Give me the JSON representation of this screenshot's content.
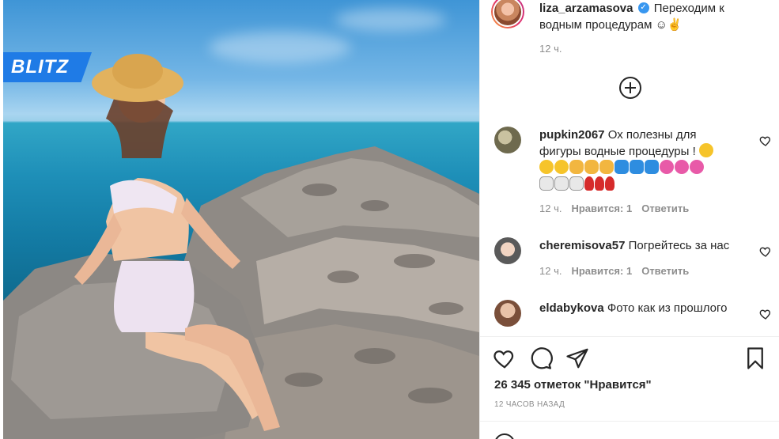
{
  "branding": {
    "logo_text": "BLITZ"
  },
  "post": {
    "author": "liza_arzamasova",
    "verified_mark": "✓",
    "caption": "Переходим к водным процедурам ☺✌",
    "time": "12 ч."
  },
  "comments": [
    {
      "user": "pupkin2067",
      "text": "Ох полезны для фигуры водные процедуры !",
      "emoji_rows": [
        [
          "smile-yellow"
        ],
        [
          "smile-yellow",
          "smile-yellow",
          "clap",
          "clap",
          "clap",
          "wave",
          "wave",
          "wave",
          "flower",
          "flower",
          "flower"
        ],
        [
          "rabbit",
          "rabbit",
          "rabbit",
          "rose",
          "rose",
          "rose"
        ]
      ],
      "time": "12 ч.",
      "likes": "Нравится: 1",
      "reply": "Ответить"
    },
    {
      "user": "cheremisova57",
      "text": "Погрейтесь за нас",
      "time": "12 ч.",
      "likes": "Нравится: 1",
      "reply": "Ответить"
    },
    {
      "user": "eldabykova",
      "text": "Фото как из прошлого"
    }
  ],
  "actions": {
    "icons": [
      "heart-icon",
      "comment-icon",
      "share-icon",
      "bookmark-icon"
    ],
    "likes_count": "26 345 отметок \"Нравится\"",
    "posted_ago": "12 ЧАСОВ НАЗАД"
  },
  "colors": {
    "accent": "#1f7be6",
    "verified": "#3897f0",
    "text": "#262626",
    "muted": "#8e8e8e"
  }
}
